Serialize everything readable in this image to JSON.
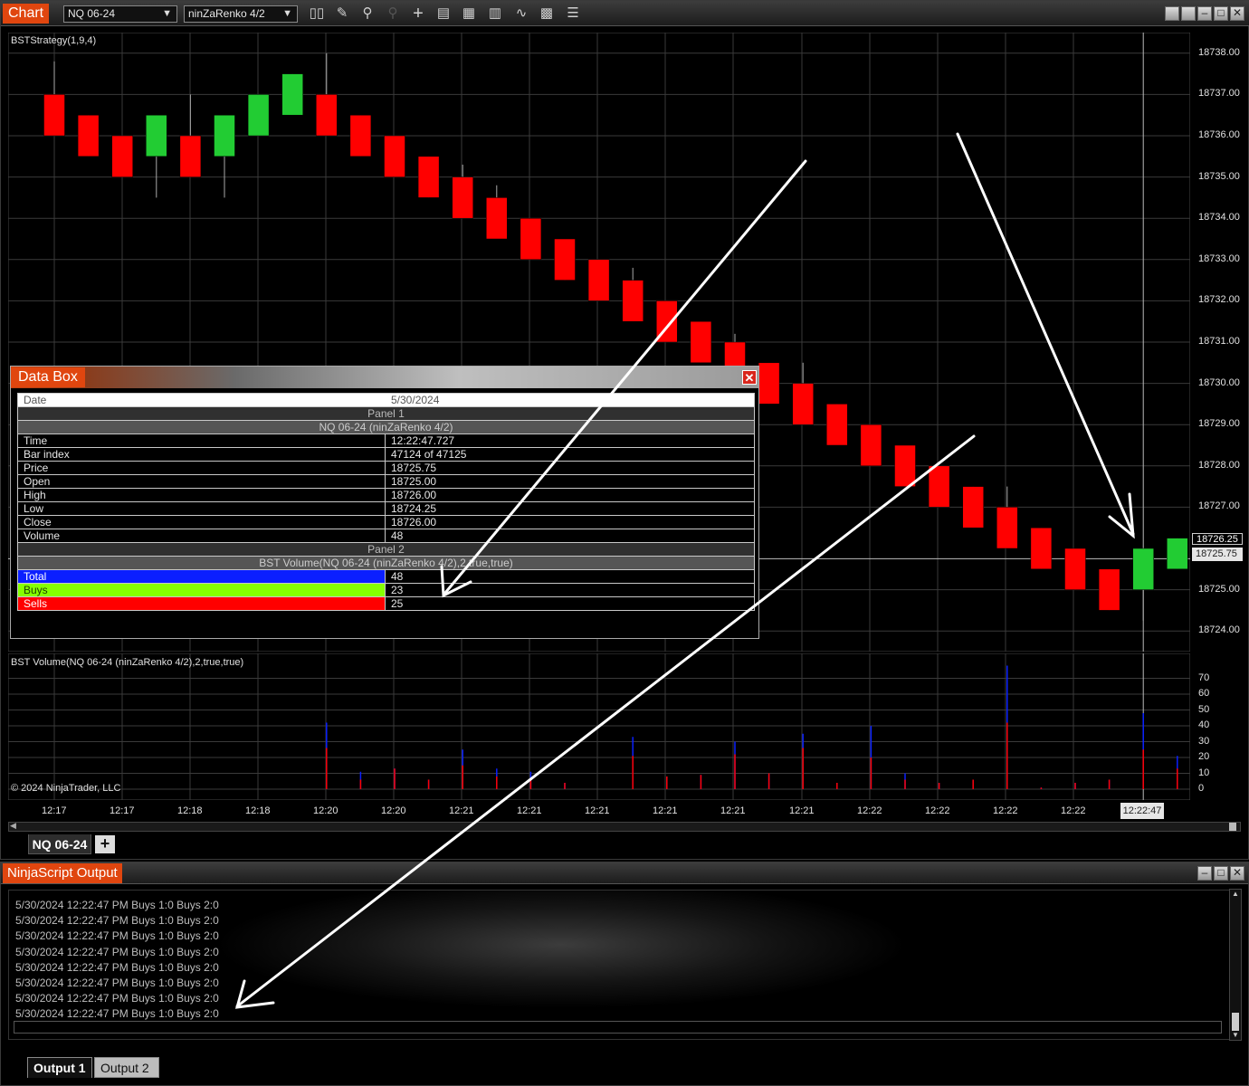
{
  "toolbar": {
    "chart_tag": "Chart",
    "instrument": "NQ 06-24",
    "bar_type": "ninZaRenko 4/2",
    "icons": [
      "bar-style-icon",
      "pencil-icon",
      "zoom-in-icon",
      "zoom-out-icon",
      "crosshair-icon",
      "properties-icon",
      "templates-icon",
      "indicators-icon",
      "strategies-icon",
      "data-box-icon",
      "list-icon"
    ]
  },
  "price_pane": {
    "title": "BSTStrategy(1,9,4)",
    "axis_labels": [
      "18738.00",
      "18737.00",
      "18736.00",
      "18735.00",
      "18734.00",
      "18733.00",
      "18732.00",
      "18731.00",
      "18730.00",
      "18729.00",
      "18728.00",
      "18727.00",
      "18725.00",
      "18724.00"
    ],
    "price_tag_last": "18726.25",
    "price_tag_cursor": "18725.75"
  },
  "volume_pane": {
    "title": "BST Volume(NQ 06-24 (ninZaRenko 4/2),2,true,true)",
    "axis_labels": [
      "70",
      "60",
      "50",
      "40",
      "30",
      "20",
      "10",
      "0"
    ]
  },
  "time_axis": {
    "labels": [
      "12:17",
      "12:17",
      "12:18",
      "12:18",
      "12:20",
      "12:20",
      "12:21",
      "12:21",
      "12:21",
      "12:21",
      "12:21",
      "12:21",
      "12:22",
      "12:22",
      "12:22",
      "12:22"
    ],
    "cursor_time": "12:22:47"
  },
  "copyright": "© 2024 NinjaTrader, LLC",
  "tabs": {
    "instrument_tab": "NQ 06-24",
    "add_tab": "+"
  },
  "data_box": {
    "title": "Data Box",
    "date_label": "Date",
    "date_value": "5/30/2024",
    "panel1": "Panel 1",
    "series1": "NQ 06-24 (ninZaRenko 4/2)",
    "rows": [
      {
        "k": "Time",
        "v": "12:22:47.727"
      },
      {
        "k": "Bar index",
        "v": "47124 of 47125"
      },
      {
        "k": "Price",
        "v": "18725.75"
      },
      {
        "k": "Open",
        "v": "18725.00"
      },
      {
        "k": "High",
        "v": "18726.00"
      },
      {
        "k": "Low",
        "v": "18724.25"
      },
      {
        "k": "Close",
        "v": "18726.00"
      },
      {
        "k": "Volume",
        "v": "48"
      }
    ],
    "panel2": "Panel 2",
    "series2": "BST Volume(NQ 06-24 (ninZaRenko 4/2),2,true,true)",
    "vol_rows": [
      {
        "k": "Total",
        "v": "48",
        "color": "#0b1fff"
      },
      {
        "k": "Buys",
        "v": "23",
        "color": "#86ff00"
      },
      {
        "k": "Sells",
        "v": "25",
        "color": "#ff0000"
      }
    ]
  },
  "output": {
    "title": "NinjaScript Output",
    "lines": [
      "5/30/2024 12:22:47 PM Buys 1:0 Buys 2:0",
      "5/30/2024 12:22:47 PM Buys 1:0 Buys 2:0",
      "5/30/2024 12:22:47 PM Buys 1:0 Buys 2:0",
      "5/30/2024 12:22:47 PM Buys 1:0 Buys 2:0",
      "5/30/2024 12:22:47 PM Buys 1:0 Buys 2:0",
      "5/30/2024 12:22:47 PM Buys 1:0 Buys 2:0",
      "5/30/2024 12:22:47 PM Buys 1:0 Buys 2:0",
      "5/30/2024 12:22:47 PM Buys 1:0 Buys 2:0"
    ],
    "tab1": "Output 1",
    "tab2": "Output 2"
  },
  "chart_data": {
    "type": "candlestick",
    "up_color": "#22cc33",
    "down_color": "#ff0000",
    "ylim": [
      18723.5,
      18738.5
    ],
    "bars": [
      {
        "o": 18736.0,
        "c": 18737.0,
        "h": 18737.8,
        "l": 18736.0,
        "dir": "down"
      },
      {
        "o": 18736.5,
        "c": 18735.5,
        "h": 18736.5,
        "l": 18735.5,
        "dir": "down"
      },
      {
        "o": 18736.0,
        "c": 18735.0,
        "h": 18736.0,
        "l": 18735.0,
        "dir": "down"
      },
      {
        "o": 18735.5,
        "c": 18736.5,
        "h": 18736.5,
        "l": 18734.5,
        "dir": "up"
      },
      {
        "o": 18736.0,
        "c": 18735.0,
        "h": 18737.0,
        "l": 18735.0,
        "dir": "down"
      },
      {
        "o": 18735.5,
        "c": 18736.5,
        "h": 18736.5,
        "l": 18734.5,
        "dir": "up"
      },
      {
        "o": 18736.0,
        "c": 18737.0,
        "h": 18737.0,
        "l": 18736.0,
        "dir": "up"
      },
      {
        "o": 18736.5,
        "c": 18737.5,
        "h": 18737.5,
        "l": 18736.5,
        "dir": "up"
      },
      {
        "o": 18737.0,
        "c": 18736.0,
        "h": 18738.0,
        "l": 18736.0,
        "dir": "down"
      },
      {
        "o": 18736.5,
        "c": 18735.5,
        "h": 18736.5,
        "l": 18735.5,
        "dir": "down"
      },
      {
        "o": 18736.0,
        "c": 18735.0,
        "h": 18736.0,
        "l": 18735.0,
        "dir": "down"
      },
      {
        "o": 18735.5,
        "c": 18734.5,
        "h": 18735.5,
        "l": 18734.5,
        "dir": "down"
      },
      {
        "o": 18735.0,
        "c": 18734.0,
        "h": 18735.3,
        "l": 18734.0,
        "dir": "down"
      },
      {
        "o": 18734.5,
        "c": 18733.5,
        "h": 18734.8,
        "l": 18733.5,
        "dir": "down"
      },
      {
        "o": 18734.0,
        "c": 18733.0,
        "h": 18734.0,
        "l": 18733.0,
        "dir": "down"
      },
      {
        "o": 18733.5,
        "c": 18732.5,
        "h": 18733.5,
        "l": 18732.5,
        "dir": "down"
      },
      {
        "o": 18733.0,
        "c": 18732.0,
        "h": 18733.0,
        "l": 18732.0,
        "dir": "down"
      },
      {
        "o": 18732.5,
        "c": 18731.5,
        "h": 18732.8,
        "l": 18731.5,
        "dir": "down"
      },
      {
        "o": 18732.0,
        "c": 18731.0,
        "h": 18732.0,
        "l": 18731.0,
        "dir": "down"
      },
      {
        "o": 18731.5,
        "c": 18730.5,
        "h": 18731.5,
        "l": 18730.5,
        "dir": "down"
      },
      {
        "o": 18731.0,
        "c": 18730.0,
        "h": 18731.2,
        "l": 18730.0,
        "dir": "down"
      },
      {
        "o": 18730.5,
        "c": 18729.5,
        "h": 18730.5,
        "l": 18729.5,
        "dir": "down"
      },
      {
        "o": 18730.0,
        "c": 18729.0,
        "h": 18730.5,
        "l": 18729.0,
        "dir": "down"
      },
      {
        "o": 18729.5,
        "c": 18728.5,
        "h": 18729.5,
        "l": 18728.5,
        "dir": "down"
      },
      {
        "o": 18729.0,
        "c": 18728.0,
        "h": 18729.0,
        "l": 18728.0,
        "dir": "down"
      },
      {
        "o": 18728.5,
        "c": 18727.5,
        "h": 18728.5,
        "l": 18727.5,
        "dir": "down"
      },
      {
        "o": 18728.0,
        "c": 18727.0,
        "h": 18728.0,
        "l": 18727.0,
        "dir": "down"
      },
      {
        "o": 18727.5,
        "c": 18726.5,
        "h": 18727.5,
        "l": 18726.5,
        "dir": "down"
      },
      {
        "o": 18727.0,
        "c": 18726.0,
        "h": 18727.5,
        "l": 18726.0,
        "dir": "down"
      },
      {
        "o": 18726.5,
        "c": 18725.5,
        "h": 18726.5,
        "l": 18725.5,
        "dir": "down"
      },
      {
        "o": 18726.0,
        "c": 18725.0,
        "h": 18726.0,
        "l": 18725.0,
        "dir": "down"
      },
      {
        "o": 18725.5,
        "c": 18724.5,
        "h": 18725.5,
        "l": 18724.5,
        "dir": "down"
      },
      {
        "o": 18725.0,
        "c": 18726.0,
        "h": 18726.0,
        "l": 18724.25,
        "dir": "up"
      },
      {
        "o": 18725.5,
        "c": 18726.25,
        "h": 18726.25,
        "l": 18725.5,
        "dir": "up"
      }
    ],
    "volume": {
      "ylim": [
        0,
        80
      ],
      "total": [
        0,
        0,
        0,
        0,
        0,
        0,
        0,
        0,
        42,
        11,
        13,
        6,
        25,
        13,
        11,
        4,
        0,
        33,
        8,
        9,
        30,
        10,
        35,
        4,
        40,
        10,
        4,
        6,
        78,
        1,
        4,
        6,
        48,
        21
      ],
      "sells": [
        0,
        0,
        0,
        0,
        0,
        0,
        0,
        0,
        26,
        6,
        13,
        6,
        15,
        8,
        6,
        4,
        0,
        21,
        8,
        9,
        22,
        10,
        26,
        4,
        20,
        6,
        4,
        6,
        42,
        1,
        4,
        6,
        25,
        13
      ]
    }
  }
}
